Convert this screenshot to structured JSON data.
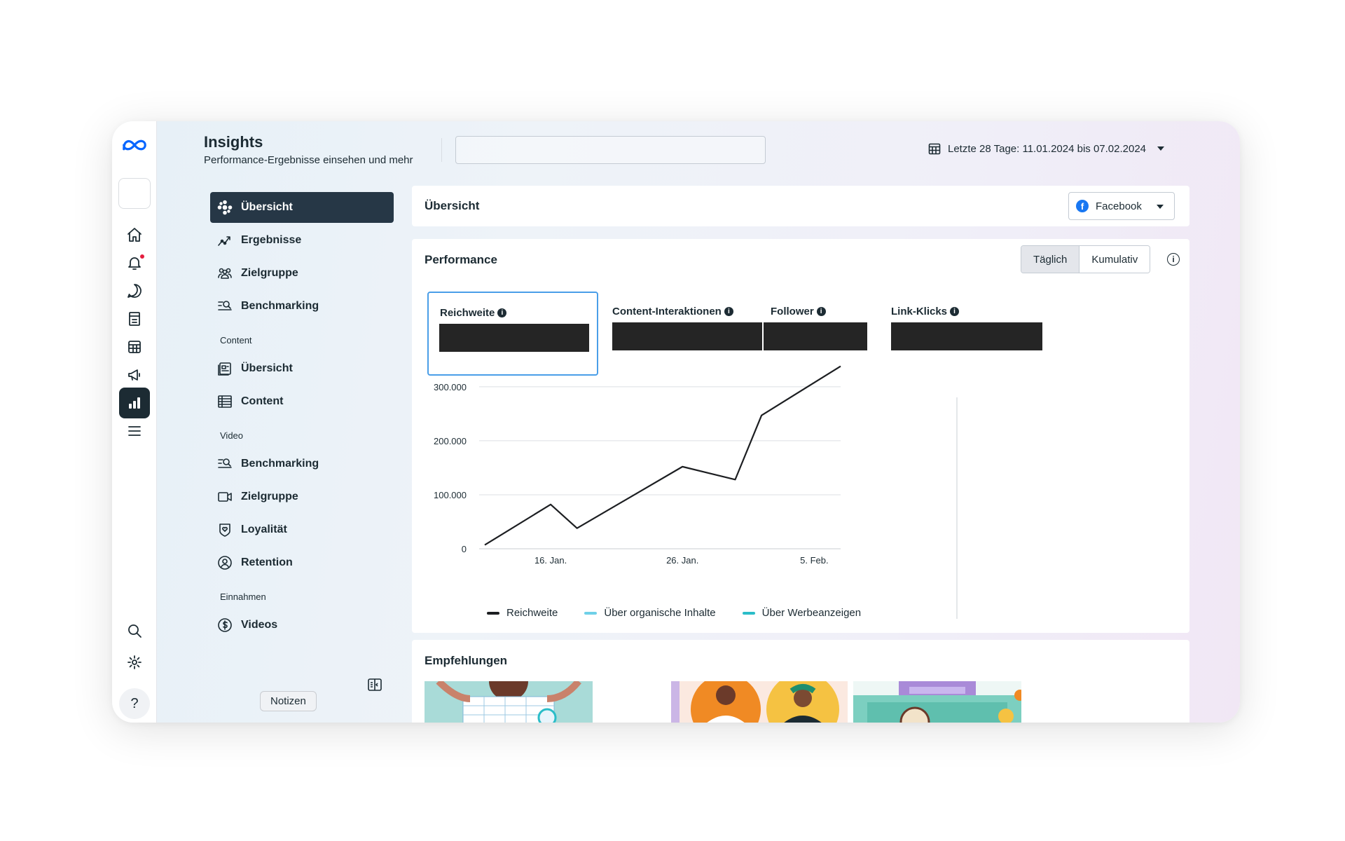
{
  "header": {
    "title": "Insights",
    "subtitle": "Performance-Ergebnisse einsehen und mehr",
    "search_value": "",
    "date_range": "Letzte 28 Tage: 11.01.2024 bis 07.02.2024"
  },
  "rail": {
    "help_label": "?",
    "icons": [
      "meta-logo-icon",
      "home-icon",
      "bell-icon",
      "chat-icon",
      "pages-icon",
      "table-icon",
      "megaphone-icon",
      "insights-chart-icon",
      "menu-icon",
      "search-icon",
      "gear-icon",
      "help-icon"
    ]
  },
  "subnav": {
    "items": [
      {
        "label": "Übersicht",
        "icon": "overview-icon",
        "active": true
      },
      {
        "label": "Ergebnisse",
        "icon": "trend-icon"
      },
      {
        "label": "Zielgruppe",
        "icon": "people-icon"
      },
      {
        "label": "Benchmarking",
        "icon": "benchmark-icon"
      }
    ],
    "content_section": "Content",
    "content_items": [
      {
        "label": "Übersicht",
        "icon": "content-overview-icon"
      },
      {
        "label": "Content",
        "icon": "table-icon"
      }
    ],
    "video_section": "Video",
    "video_items": [
      {
        "label": "Benchmarking",
        "icon": "benchmark-icon"
      },
      {
        "label": "Zielgruppe",
        "icon": "video-icon"
      },
      {
        "label": "Loyalität",
        "icon": "shield-heart-icon"
      },
      {
        "label": "Retention",
        "icon": "user-circle-icon"
      }
    ],
    "income_section": "Einnahmen",
    "income_items": [
      {
        "label": "Videos",
        "icon": "dollar-icon"
      }
    ],
    "notes_tooltip": "Notizen"
  },
  "overview_card": {
    "title": "Übersicht",
    "platform_select": "Facebook"
  },
  "performance": {
    "title": "Performance",
    "toggle": [
      "Täglich",
      "Kumulativ"
    ],
    "toggle_selected": "Täglich",
    "info_label": "i",
    "info_glyph": "i",
    "metrics": [
      {
        "label": "Reichweite",
        "selected": true,
        "value_redacted": true
      },
      {
        "label": "Content-Interaktionen",
        "value_redacted": true
      },
      {
        "label": "Follower",
        "value_redacted": true
      },
      {
        "label": "Link-Klicks",
        "value_redacted": true
      }
    ]
  },
  "chart_data": {
    "type": "line",
    "x": [
      "11. Jan.",
      "16. Jan.",
      "18. Jan.",
      "26. Jan.",
      "30. Jan.",
      "1. Feb.",
      "7. Feb."
    ],
    "x_positions_days": [
      0,
      5,
      7,
      15,
      19,
      21,
      27
    ],
    "series": [
      {
        "name": "Reichweite",
        "color": "#1c1e21",
        "values": [
          7000,
          82000,
          38000,
          152000,
          128000,
          247000,
          338000
        ]
      }
    ],
    "legend": [
      {
        "name": "Reichweite",
        "color": "#1c1e21"
      },
      {
        "name": "Über organische Inhalte",
        "color": "#6fd0e8"
      },
      {
        "name": "Über Werbeanzeigen",
        "color": "#2bbdc8"
      }
    ],
    "y_ticks": [
      "0",
      "100.000",
      "200.000",
      "300.000"
    ],
    "y_tick_values": [
      0,
      100000,
      200000,
      300000
    ],
    "x_ticks": [
      "16. Jan.",
      "26. Jan.",
      "5. Feb."
    ],
    "x_tick_days": [
      5,
      15,
      25
    ],
    "ylim": [
      0,
      300000
    ],
    "grid": true,
    "legend_position": "bottom"
  },
  "recommendations": {
    "title": "Empfehlungen"
  }
}
